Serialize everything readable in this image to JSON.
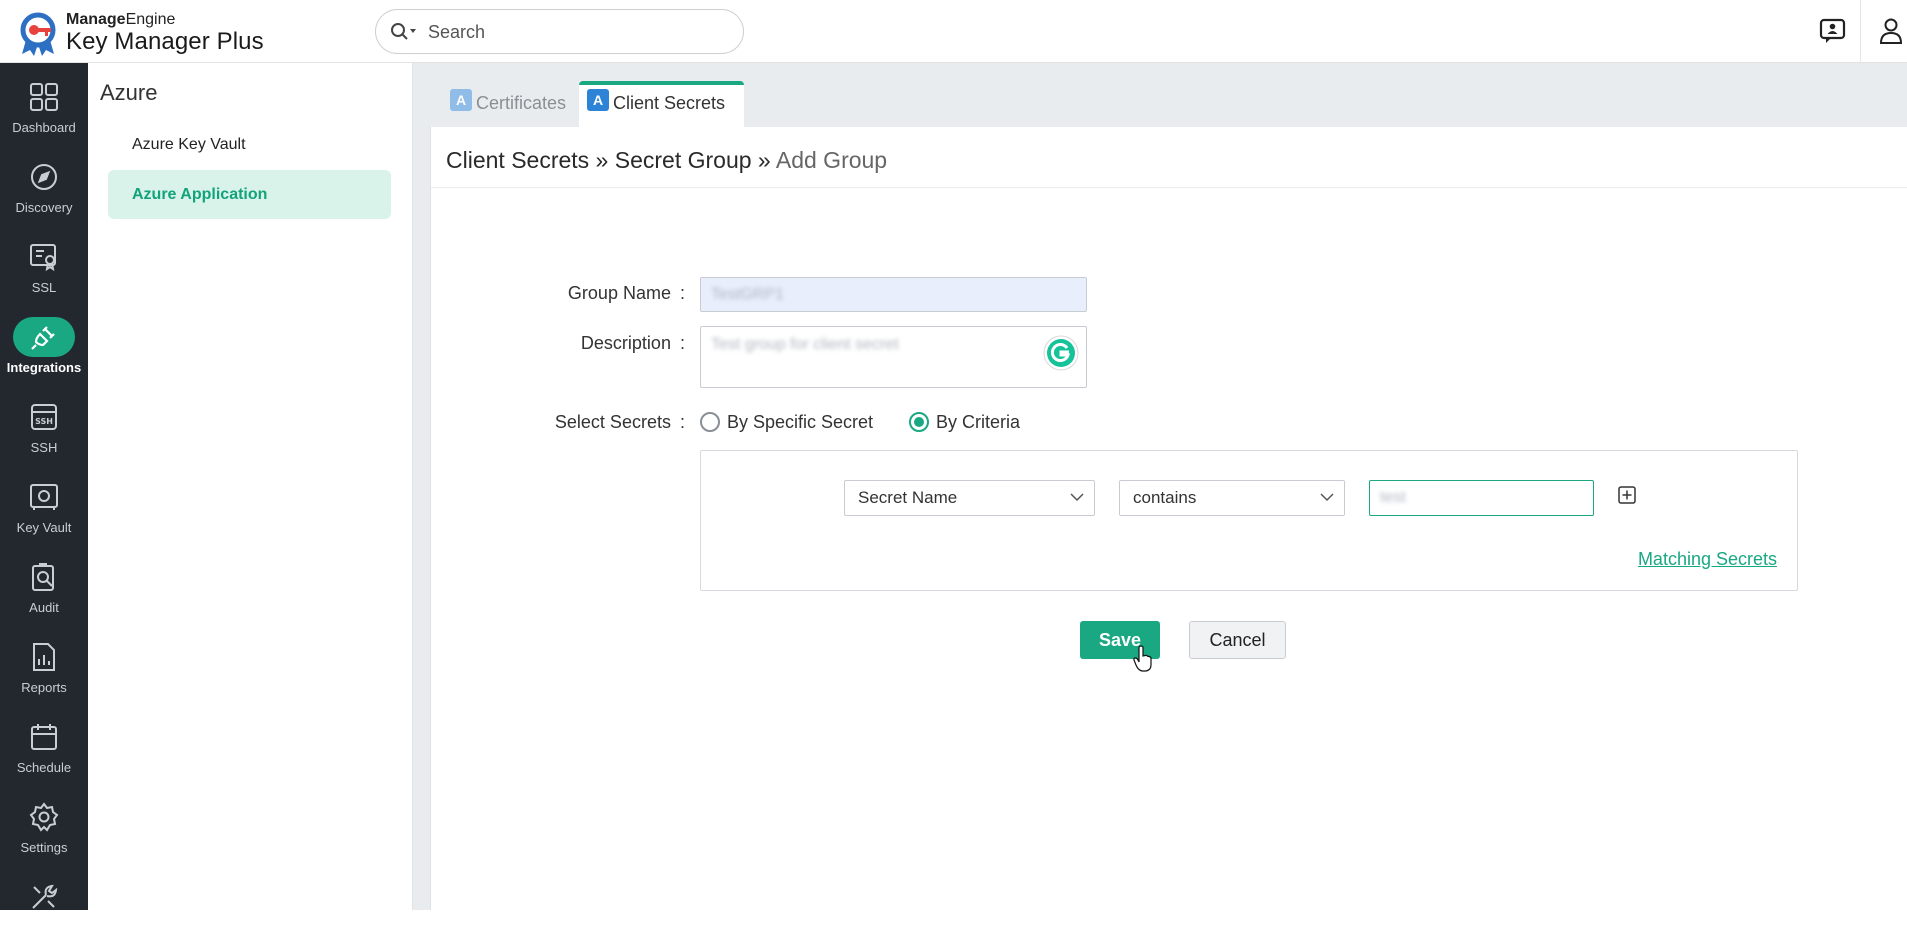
{
  "brand": {
    "vendor_bold": "Manage",
    "vendor_rest": "Engine",
    "product": "Key Manager Plus"
  },
  "search": {
    "placeholder": "Search"
  },
  "leftnav": [
    {
      "label": "Dashboard",
      "icon": "dashboard-icon"
    },
    {
      "label": "Discovery",
      "icon": "compass-icon"
    },
    {
      "label": "SSL",
      "icon": "certificate-icon"
    },
    {
      "label": "Integrations",
      "icon": "plug-icon",
      "active": true
    },
    {
      "label": "SSH",
      "icon": "ssh-icon"
    },
    {
      "label": "Key Vault",
      "icon": "vault-icon"
    },
    {
      "label": "Audit",
      "icon": "audit-icon"
    },
    {
      "label": "Reports",
      "icon": "reports-icon"
    },
    {
      "label": "Schedule",
      "icon": "calendar-icon"
    },
    {
      "label": "Settings",
      "icon": "gear-icon"
    }
  ],
  "subnav": {
    "title": "Azure",
    "items": [
      {
        "label": "Azure Key Vault"
      },
      {
        "label": "Azure Application",
        "active": true
      }
    ]
  },
  "tabs": [
    {
      "label": "Certificates",
      "active": false
    },
    {
      "label": "Client Secrets",
      "active": true
    }
  ],
  "breadcrumb": {
    "part1": "Client Secrets",
    "sep": " » ",
    "part2": "Secret Group",
    "part3": "Add Group"
  },
  "form": {
    "group_name_label": "Group Name",
    "group_name_value": "TestGRP1",
    "description_label": "Description",
    "description_value": "Test group for client secret",
    "select_secrets_label": "Select Secrets",
    "colon": ":",
    "radio_specific": "By Specific Secret",
    "radio_criteria": "By Criteria",
    "criteria_field": "Secret Name",
    "criteria_operator": "contains",
    "criteria_value": "test",
    "matching_link": "Matching Secrets"
  },
  "buttons": {
    "save": "Save",
    "cancel": "Cancel"
  },
  "colors": {
    "accent": "#1aa882",
    "nav_bg": "#22282e",
    "tab_icon": "#2d83d6"
  }
}
